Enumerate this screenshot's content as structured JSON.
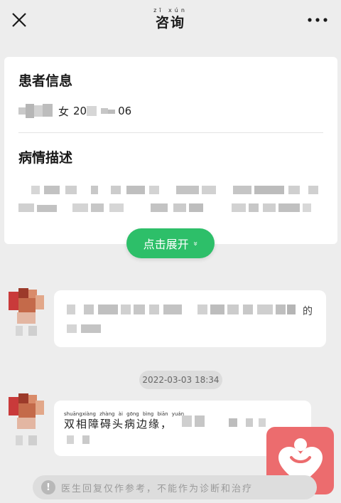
{
  "header": {
    "title": "咨询",
    "title_ruby": "zī xún"
  },
  "patient_card": {
    "info_heading": "患者信息",
    "gender": "女",
    "birth_prefix": "20",
    "birth_suffix": "06",
    "desc_heading": "病情描述"
  },
  "expand_button": {
    "label": "点击展开",
    "chevron": "»"
  },
  "chat": {
    "timestamp": "2022-03-03  18:34",
    "message_text": "双相障碍头病边缘，",
    "message_ruby": "shuāngxiàng zhàng ài gōng bìng biān yuán",
    "first_message_tail": "的"
  },
  "disclaimer": {
    "icon": "!",
    "text": "医生回复仅作参考，不能作为诊断和治疗"
  },
  "colors": {
    "accent": "#2dbf69",
    "fab": "#ec6c6e",
    "background": "#ededed"
  },
  "icons": [
    "close-icon",
    "more-icon",
    "chevron-down-icon",
    "heart-icon",
    "info-icon"
  ]
}
